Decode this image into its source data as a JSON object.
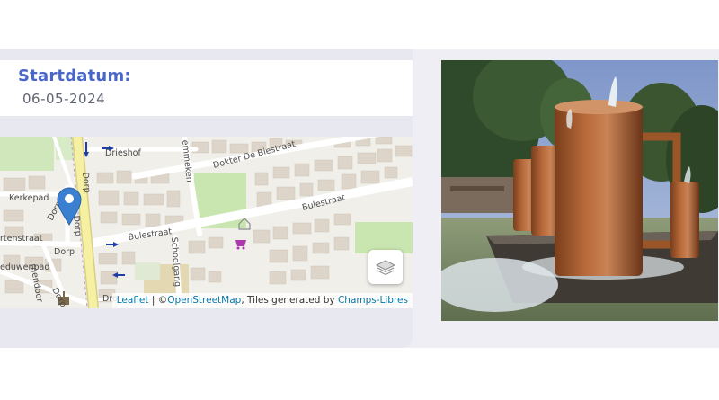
{
  "event": {
    "start_label": "Startdatum:",
    "start_date": "06-05-2024"
  },
  "map": {
    "street_labels": {
      "drieshof": "Drieshof",
      "dokter_de_biestraat": "Dokter De Biestraat",
      "kerkepad": "Kerkepad",
      "dorp_1": "Dorp",
      "dorp_2": "Dorp",
      "dorp_3": "Dorp",
      "dorp_4": "Dorp",
      "dorp_5": "Dorp",
      "bulestraat_1": "Bulestraat",
      "bulestraat_2": "Bulestraat",
      "schoolgang": "Schoolgang",
      "emmeken": "emmeken",
      "rtenstraat": "rtenstraat",
      "eduwenpad": "eduwenpad",
      "rnendoor": "rnendoor",
      "dro": "Dro"
    },
    "layers_button_icon": "layers-icon",
    "marker_icon": "map-marker-icon",
    "attribution": {
      "leaflet": "Leaflet",
      "separator": " | ©",
      "osm": "OpenStreetMap",
      "tiles_text": ", Tiles generated by ",
      "provider": "Champs-Libres"
    }
  },
  "photo": {
    "subject": "fountain-photo"
  },
  "colors": {
    "accent": "#4a66c9",
    "date_text": "#5f6470",
    "marker": "#3a7fd0",
    "main_road": "#f5f0a2",
    "park": "#c9e6b0"
  }
}
